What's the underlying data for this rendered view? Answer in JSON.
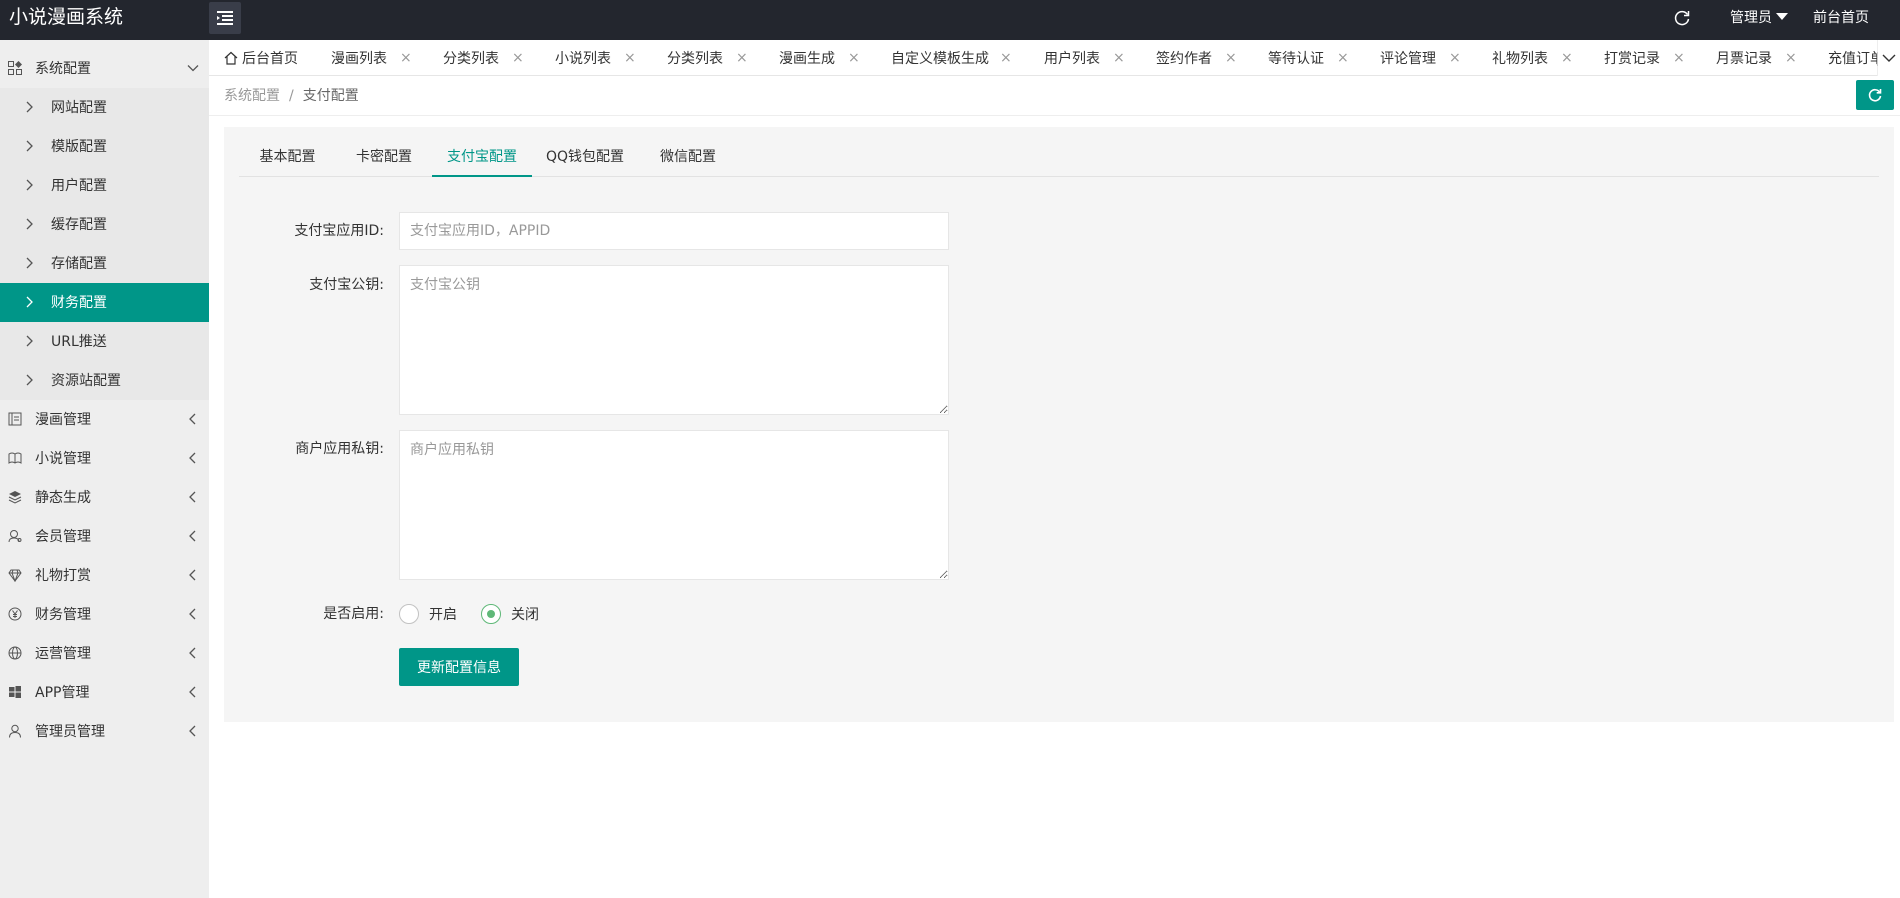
{
  "app": {
    "title": "小说漫画系统"
  },
  "header": {
    "admin_label": "管理员",
    "front_label": "前台首页"
  },
  "sidebar": {
    "groups": [
      {
        "label": "系统配置",
        "expanded": true
      },
      {
        "label": "漫画管理"
      },
      {
        "label": "小说管理"
      },
      {
        "label": "静态生成"
      },
      {
        "label": "会员管理"
      },
      {
        "label": "礼物打赏"
      },
      {
        "label": "财务管理"
      },
      {
        "label": "运营管理"
      },
      {
        "label": "APP管理"
      },
      {
        "label": "管理员管理"
      }
    ],
    "sub_items": [
      {
        "label": "网站配置"
      },
      {
        "label": "模版配置"
      },
      {
        "label": "用户配置"
      },
      {
        "label": "缓存配置"
      },
      {
        "label": "存储配置"
      },
      {
        "label": "财务配置",
        "active": true
      },
      {
        "label": "URL推送"
      },
      {
        "label": "资源站配置"
      }
    ]
  },
  "tabbar": {
    "tabs": [
      {
        "label": "后台首页"
      },
      {
        "label": "漫画列表"
      },
      {
        "label": "分类列表"
      },
      {
        "label": "小说列表"
      },
      {
        "label": "分类列表"
      },
      {
        "label": "漫画生成"
      },
      {
        "label": "自定义模板生成"
      },
      {
        "label": "用户列表"
      },
      {
        "label": "签约作者"
      },
      {
        "label": "等待认证"
      },
      {
        "label": "评论管理"
      },
      {
        "label": "礼物列表"
      },
      {
        "label": "打赏记录"
      },
      {
        "label": "月票记录"
      },
      {
        "label": "充值订单"
      }
    ],
    "close_glyph": "×"
  },
  "breadcrumb": {
    "parent": "系统配置",
    "separator": "/",
    "current": "支付配置"
  },
  "config_tabs": [
    {
      "label": "基本配置"
    },
    {
      "label": "卡密配置"
    },
    {
      "label": "支付宝配置",
      "active": true
    },
    {
      "label": "QQ钱包配置"
    },
    {
      "label": "微信配置"
    }
  ],
  "form": {
    "app_id": {
      "label": "支付宝应用ID:",
      "value": "",
      "placeholder": "支付宝应用ID，APPID"
    },
    "public_key": {
      "label": "支付宝公钥:",
      "value": "",
      "placeholder": "支付宝公钥"
    },
    "private_key": {
      "label": "商户应用私钥:",
      "value": "",
      "placeholder": "商户应用私钥"
    },
    "enabled": {
      "label": "是否启用:",
      "options": [
        "开启",
        "关闭"
      ],
      "selected": "关闭"
    },
    "submit_label": "更新配置信息"
  },
  "colors": {
    "accent": "#009688",
    "header_bg": "#23262e",
    "radio_checked": "#5fb878"
  }
}
